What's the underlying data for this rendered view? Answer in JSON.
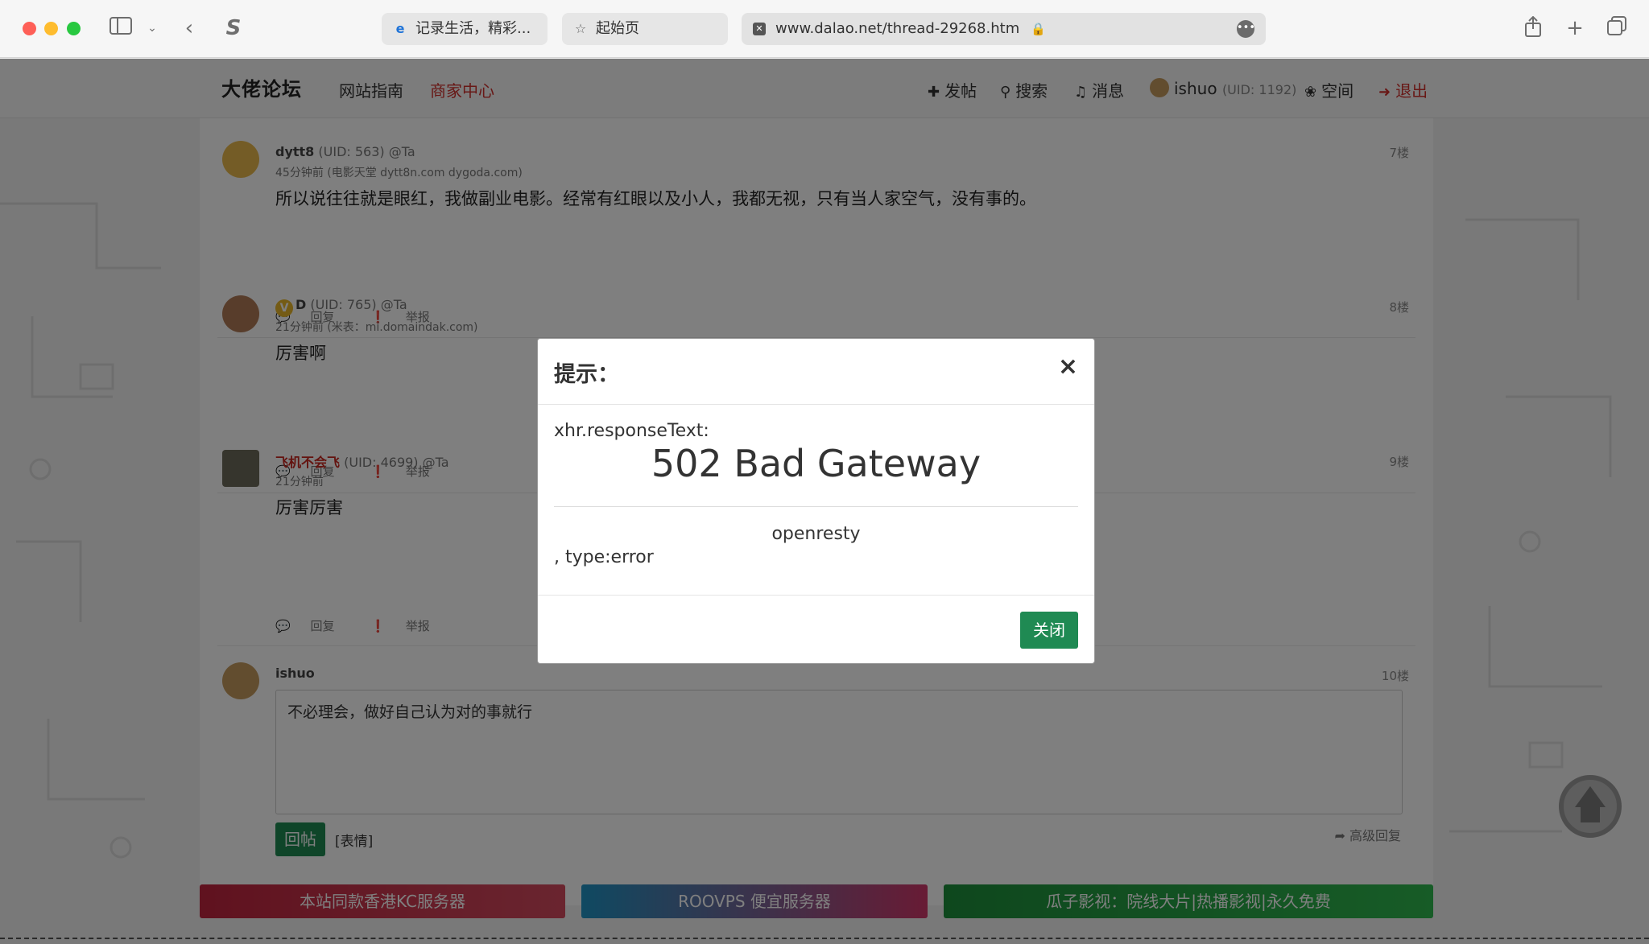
{
  "browser": {
    "tabs": [
      {
        "label": "记录生活，精彩...",
        "icon": "ie-icon"
      },
      {
        "label": "起始页",
        "icon": "star-icon"
      }
    ],
    "address": "www.dalao.net/thread-29268.htm"
  },
  "navbar": {
    "brand": "大佬论坛",
    "links": [
      "网站指南",
      "商家中心"
    ],
    "post": "发帖",
    "search": "搜索",
    "messages": "消息",
    "user": "ishuo",
    "user_uid": "(UID: 1192)",
    "space": "空间",
    "logout": "退出"
  },
  "posts": [
    {
      "user": "dytt8",
      "meta": "(UID: 563) @Ta",
      "time": "45分钟前 (电影天堂 dytt8n.com dygoda.com)",
      "body": "所以说往往就是眼红，我做副业电影。经常有红眼以及小人，我都无视，只有当人家空气，没有事的。",
      "floor": "7楼"
    },
    {
      "user": "D",
      "meta": "(UID: 765) @Ta",
      "time": "21分钟前 (米表：mi.domaindak.com)",
      "body": "厉害啊",
      "floor": "8楼"
    },
    {
      "user": "飞机不会飞",
      "meta": "(UID: 4699) @Ta",
      "time": "21分钟前",
      "body": "厉害厉害",
      "floor": "9楼"
    }
  ],
  "actions": {
    "reply": "回复",
    "report": "举报"
  },
  "composer": {
    "user": "ishuo",
    "floor": "10楼",
    "text": "不必理会，做好自己认为对的事就行",
    "submit": "回帖",
    "emoji": "[表情]",
    "advanced": "高级回复"
  },
  "banners": [
    "本站同款香港KC服务器",
    "ROOVPS 便宜服务器",
    "瓜子影视：院线大片|热播影视|永久免费"
  ],
  "modal": {
    "title": "提示：",
    "label": "xhr.responseText:",
    "heading": "502 Bad Gateway",
    "server": "openresty",
    "type": ", type:error",
    "close": "关闭"
  },
  "colors": {
    "accent": "#1f8a53",
    "red": "#d0312d"
  }
}
